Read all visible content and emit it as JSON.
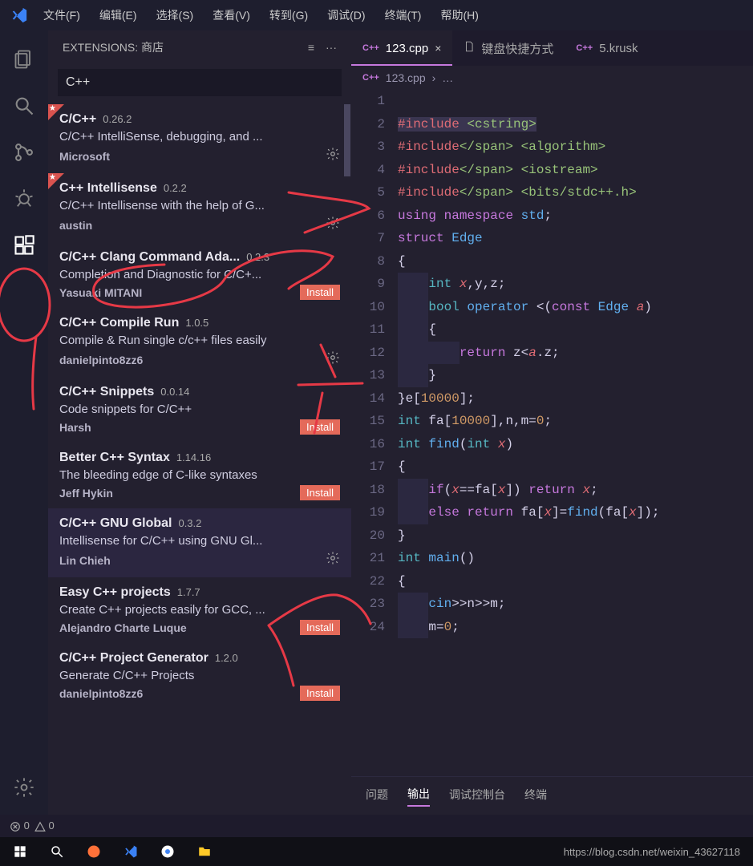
{
  "menubar": [
    "文件(F)",
    "编辑(E)",
    "选择(S)",
    "查看(V)",
    "转到(G)",
    "调试(D)",
    "终端(T)",
    "帮助(H)"
  ],
  "sidebar": {
    "title": "EXTENSIONS: 商店",
    "search": "C++"
  },
  "extensions": [
    {
      "name": "C/C++",
      "ver": "0.26.2",
      "desc": "C/C++ IntelliSense, debugging, and ...",
      "author": "Microsoft",
      "star": true,
      "action": "gear"
    },
    {
      "name": "C++ Intellisense",
      "ver": "0.2.2",
      "desc": "C/C++ Intellisense with the help of G...",
      "author": "austin",
      "star": true,
      "action": "gear"
    },
    {
      "name": "C/C++ Clang Command Ada...",
      "ver": "0.2.3",
      "desc": "Completion and Diagnostic for C/C+...",
      "author": "Yasuaki MITANI",
      "star": false,
      "action": "install"
    },
    {
      "name": "C/C++ Compile Run",
      "ver": "1.0.5",
      "desc": "Compile & Run single c/c++ files easily",
      "author": "danielpinto8zz6",
      "star": false,
      "action": "gear"
    },
    {
      "name": "C/C++ Snippets",
      "ver": "0.0.14",
      "desc": "Code snippets for C/C++",
      "author": "Harsh",
      "star": false,
      "action": "install"
    },
    {
      "name": "Better C++ Syntax",
      "ver": "1.14.16",
      "desc": "The bleeding edge of C-like syntaxes",
      "author": "Jeff Hykin",
      "star": false,
      "action": "install"
    },
    {
      "name": "C/C++ GNU Global",
      "ver": "0.3.2",
      "desc": "Intellisense for C/C++ using GNU Gl...",
      "author": "Lin Chieh",
      "star": false,
      "action": "gear",
      "selected": true
    },
    {
      "name": "Easy C++ projects",
      "ver": "1.7.7",
      "desc": "Create C++ projects easily for GCC, ...",
      "author": "Alejandro Charte Luque",
      "star": false,
      "action": "install"
    },
    {
      "name": "C/C++ Project Generator",
      "ver": "1.2.0",
      "desc": "Generate C/C++ Projects",
      "author": "danielpinto8zz6",
      "star": false,
      "action": "install"
    }
  ],
  "install_label": "Install",
  "tabs": [
    {
      "icon": "cpp",
      "label": "123.cpp",
      "active": true,
      "close": true
    },
    {
      "icon": "file",
      "label": "键盘快捷方式",
      "active": false
    },
    {
      "icon": "cpp",
      "label": "5.krusk",
      "active": false
    }
  ],
  "breadcrumb": {
    "file": "123.cpp",
    "more": "…"
  },
  "code": [
    "",
    "#include <cstring>",
    "#include <algorithm>",
    "#include <iostream>",
    "#include <bits/stdc++.h>",
    "using namespace std;",
    "struct Edge",
    "{",
    "    int x,y,z;",
    "    bool operator <(const Edge a)",
    "    {",
    "        return z<a.z;",
    "    }",
    "}e[10000];",
    "int fa[10000],n,m=0;",
    "int find(int x)",
    "{",
    "    if(x==fa[x]) return x;",
    "    else return fa[x]=find(fa[x]);",
    "}",
    "int main()",
    "{",
    "    cin>>n>>m;",
    "    m=0;"
  ],
  "panel_tabs": [
    "问题",
    "输出",
    "调试控制台",
    "终端"
  ],
  "panel_active": 1,
  "statusbar": {
    "errors": "0",
    "warnings": "0"
  },
  "watermark": "https://blog.csdn.net/weixin_43627118"
}
